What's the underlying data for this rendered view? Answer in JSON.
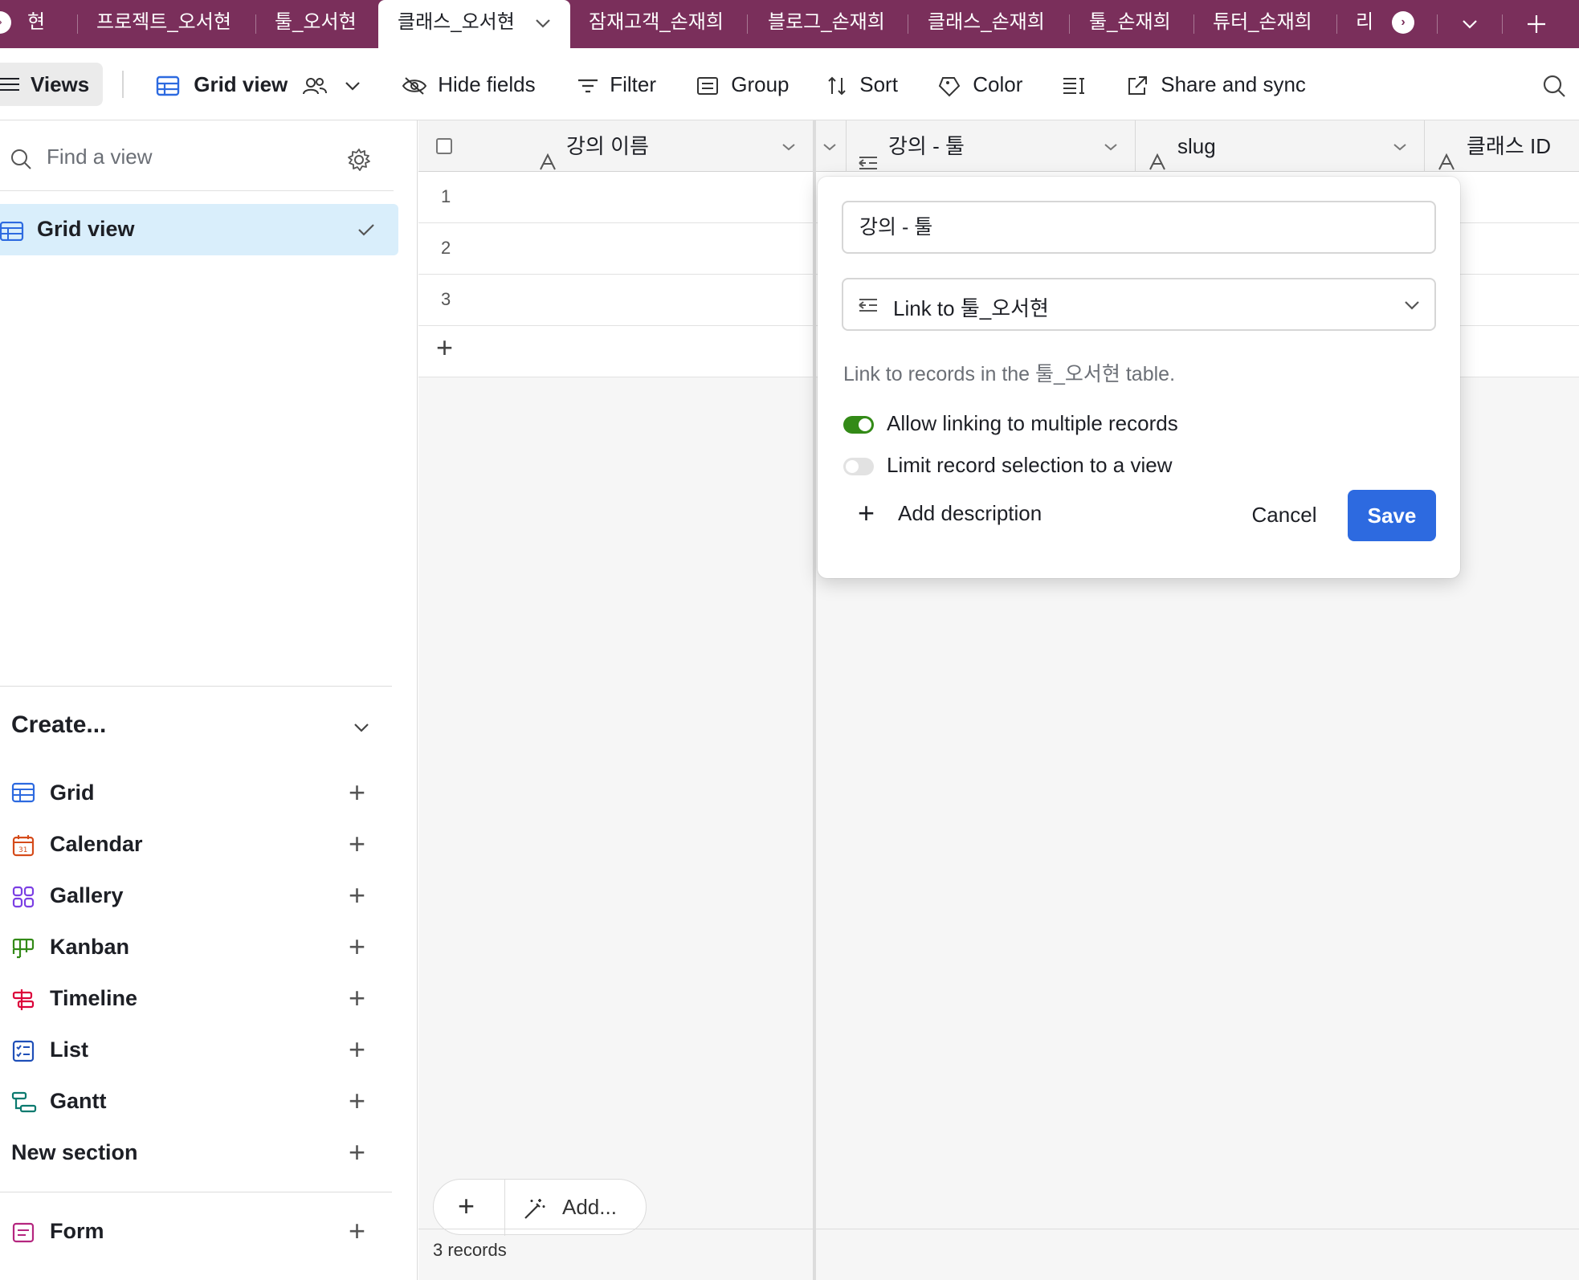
{
  "tabs": {
    "items": [
      {
        "label": "현"
      },
      {
        "label": "프로젝트_오서현"
      },
      {
        "label": "툴_오서현"
      },
      {
        "label": "클래스_오서현"
      },
      {
        "label": "잠재고객_손재희"
      },
      {
        "label": "블로그_손재희"
      },
      {
        "label": "클래스_손재희"
      },
      {
        "label": "툴_손재희"
      },
      {
        "label": "튜터_손재희"
      },
      {
        "label": "리"
      }
    ],
    "active_index": 3
  },
  "toolbar": {
    "views_label": "Views",
    "view_name": "Grid view",
    "hide_fields": "Hide fields",
    "filter": "Filter",
    "group": "Group",
    "sort": "Sort",
    "color": "Color",
    "share": "Share and sync"
  },
  "sidebar": {
    "find_placeholder": "Find a view",
    "views": [
      {
        "label": "Grid view",
        "selected": true
      }
    ],
    "create_header": "Create...",
    "create_items": [
      {
        "label": "Grid",
        "icon": "grid-icon",
        "color": "#2d6ae0"
      },
      {
        "label": "Calendar",
        "icon": "calendar-icon",
        "color": "#d54b1a"
      },
      {
        "label": "Gallery",
        "icon": "gallery-icon",
        "color": "#7b3fe4"
      },
      {
        "label": "Kanban",
        "icon": "kanban-icon",
        "color": "#338a17"
      },
      {
        "label": "Timeline",
        "icon": "timeline-icon",
        "color": "#dc043b"
      },
      {
        "label": "List",
        "icon": "list-icon",
        "color": "#1f4fb8"
      },
      {
        "label": "Gantt",
        "icon": "gantt-icon",
        "color": "#0b7a6f"
      },
      {
        "label": "New section",
        "icon": "",
        "color": ""
      }
    ],
    "form_item": {
      "label": "Form",
      "icon": "form-icon",
      "color": "#b5267f"
    }
  },
  "grid": {
    "columns": [
      {
        "label": "강의 이름",
        "icon": "text-field-icon"
      },
      {
        "label": "강의 - 툴",
        "icon": "link-field-icon"
      },
      {
        "label": "slug",
        "icon": "text-field-icon"
      },
      {
        "label": "클래스 ID",
        "icon": "text-field-icon"
      }
    ],
    "rows": [
      {
        "num": "1"
      },
      {
        "num": "2"
      },
      {
        "num": "3"
      }
    ],
    "add_label": "Add...",
    "records_count": "3 records"
  },
  "popover": {
    "field_name": "강의 - 툴",
    "field_type": "Link to 툴_오서현",
    "description": "Link to records in the 툴_오서현 table.",
    "allow_multiple_label": "Allow linking to multiple records",
    "allow_multiple_on": true,
    "limit_view_label": "Limit record selection to a view",
    "limit_view_on": false,
    "add_description": "Add description",
    "cancel": "Cancel",
    "save": "Save",
    "accent_color": "#2d6ae0",
    "toggle_on_color": "#338a17"
  },
  "theme": {
    "tabbar_color": "#7a2f5b",
    "selected_view_bg": "#d9eefb"
  }
}
